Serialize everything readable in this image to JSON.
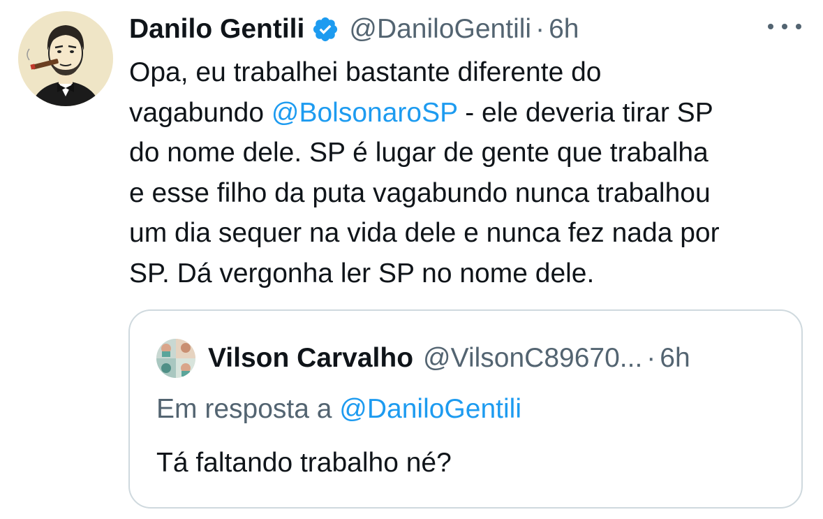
{
  "tweet": {
    "author": {
      "display_name": "Danilo Gentili",
      "handle": "@DaniloGentili",
      "verified": true,
      "avatar_icon": "cartoon-man-with-cigar-avatar"
    },
    "separator": "·",
    "time": "6h",
    "more_icon": "more-horizontal-icon",
    "body": {
      "line1": "Opa, eu trabalhei bastante diferente do",
      "line2_before": "vagabundo ",
      "line2_mention": "@BolsonaroSP",
      "line2_after": " - ele deveria tirar SP",
      "line3": "do nome dele. SP é lugar de gente que trabalha",
      "line4": "e esse filho da puta vagabundo nunca trabalhou",
      "line5": "um dia sequer na vida dele e nunca fez nada por",
      "line6": "SP. Dá vergonha ler SP no nome dele."
    },
    "quote": {
      "author": {
        "display_name": "Vilson Carvalho",
        "handle": "@VilsonC89670...",
        "avatar_icon": "photo-collage-avatar"
      },
      "separator": "·",
      "time": "6h",
      "reply_prefix": "Em resposta a ",
      "reply_mention": "@DaniloGentili",
      "text": "Tá faltando trabalho né?"
    }
  },
  "colors": {
    "text_primary": "#0f1419",
    "text_secondary": "#536471",
    "link": "#1d9bf0",
    "verified": "#1d9bf0",
    "border": "#cfd9de"
  }
}
